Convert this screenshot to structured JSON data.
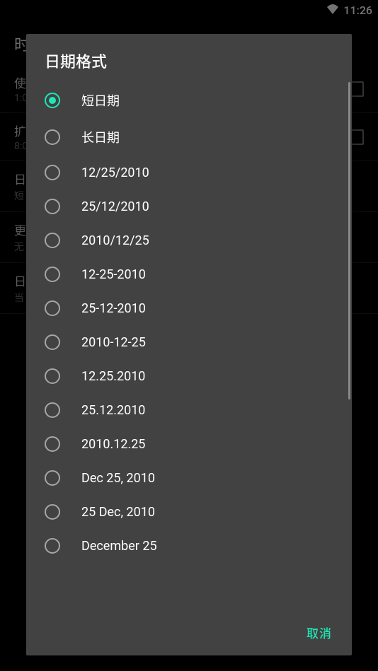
{
  "status_bar": {
    "time": "11:26"
  },
  "background": {
    "title": "时",
    "items": [
      {
        "primary": "使",
        "secondary": "1:0",
        "checkbox": true
      },
      {
        "primary": "扩",
        "secondary": "8:0",
        "checkbox": true
      },
      {
        "primary": "日",
        "secondary": "短",
        "checkbox": false
      },
      {
        "primary": "更",
        "secondary": "无",
        "checkbox": false
      },
      {
        "primary": "日",
        "secondary": "当",
        "checkbox": false
      }
    ]
  },
  "dialog": {
    "title": "日期格式",
    "selected_index": 0,
    "options": [
      "短日期",
      "长日期",
      "12/25/2010",
      "25/12/2010",
      "2010/12/25",
      "12-25-2010",
      "25-12-2010",
      "2010-12-25",
      "12.25.2010",
      "25.12.2010",
      "2010.12.25",
      "Dec 25, 2010",
      "25 Dec, 2010",
      "December 25"
    ],
    "cancel_label": "取消"
  }
}
